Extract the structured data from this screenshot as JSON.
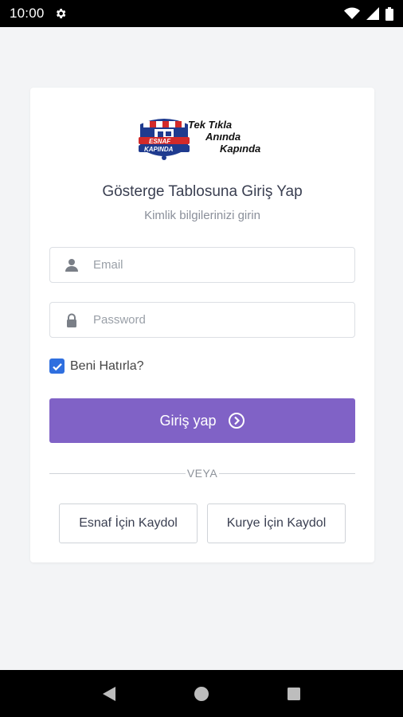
{
  "status_bar": {
    "time": "10:00"
  },
  "logo": {
    "brand_top": "ESNAF",
    "brand_bottom": "KAPINDA",
    "tagline_1": "Tek Tıkla",
    "tagline_2": "Anında",
    "tagline_3": "Kapında"
  },
  "login": {
    "title": "Gösterge Tablosuna Giriş Yap",
    "subtitle": "Kimlik bilgilerinizi girin",
    "email_placeholder": "Email",
    "password_placeholder": "Password",
    "remember_label": "Beni Hatırla?",
    "submit_label": "Giriş yap",
    "divider_text": "VEYA",
    "register_merchant_label": "Esnaf İçin Kaydol",
    "register_courier_label": "Kurye İçin Kaydol"
  },
  "colors": {
    "primary": "#8062c6",
    "checkbox": "#2f6fdf",
    "background": "#f3f4f6"
  }
}
